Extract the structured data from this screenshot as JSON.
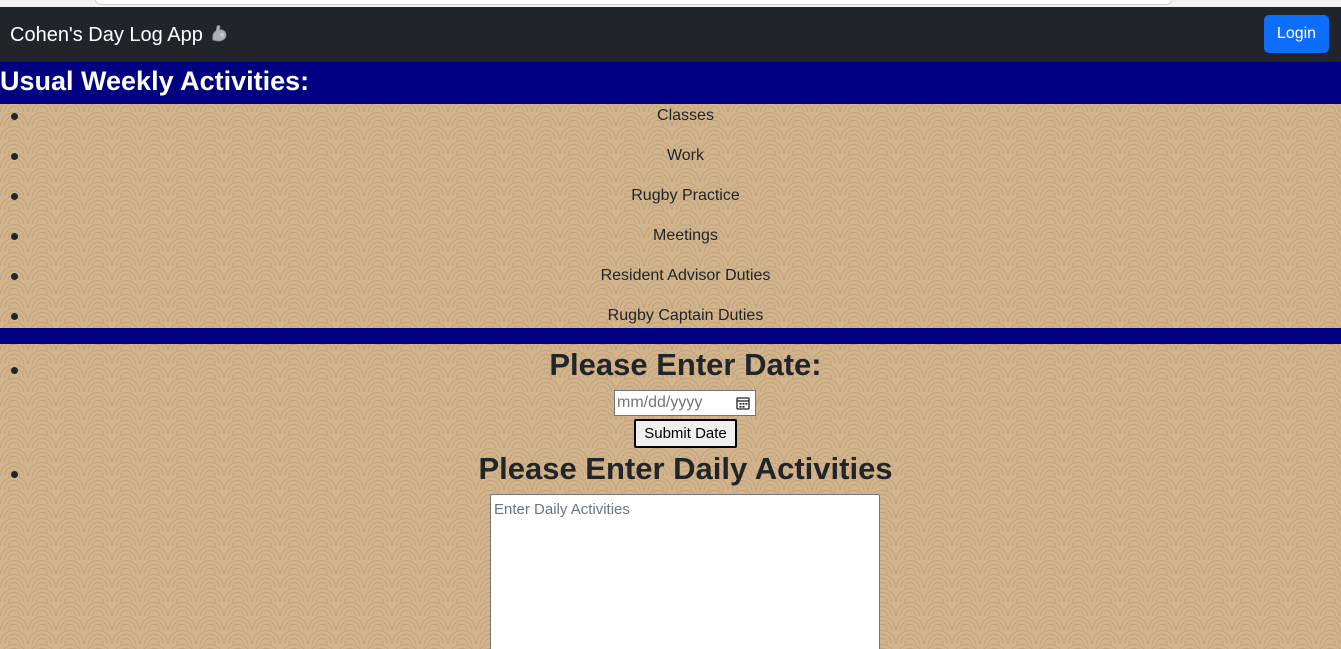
{
  "navbar": {
    "brand": "Cohen's Day Log App",
    "brand_icon": "flexed-bicep-icon",
    "login_label": "Login",
    "background": "#212529",
    "login_color": "#0d6efd"
  },
  "weekly": {
    "heading": "Usual Weekly Activities:",
    "header_color": "#000080",
    "items": [
      {
        "label": "Classes"
      },
      {
        "label": "Work"
      },
      {
        "label": "Rugby Practice"
      },
      {
        "label": "Meetings"
      },
      {
        "label": "Resident Advisor Duties"
      },
      {
        "label": "Rugby Captain Duties"
      }
    ]
  },
  "date_form": {
    "heading": "Please Enter Date:",
    "date_placeholder": "mm/dd/yyyy",
    "submit_label": "Submit Date",
    "calendar_icon": "calendar-icon"
  },
  "daily_form": {
    "heading": "Please Enter Daily Activities",
    "textarea_placeholder": "Enter Daily Activities"
  },
  "page": {
    "background_color": "#d2b48c"
  }
}
